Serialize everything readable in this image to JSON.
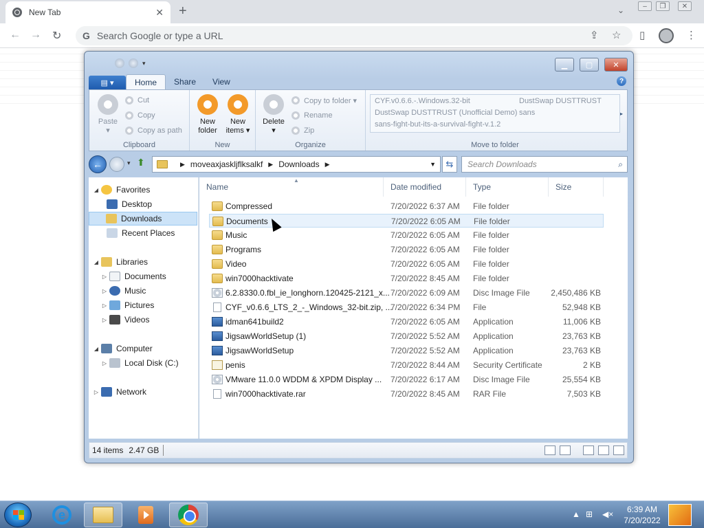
{
  "browser": {
    "tab_title": "New Tab",
    "tab_close": "✕",
    "new_tab": "+",
    "omnibox_placeholder": "Search Google or type a URL",
    "g_letter": "G"
  },
  "explorer": {
    "ribbon_tabs": [
      "Home",
      "Share",
      "View"
    ],
    "clipboard": {
      "paste": "Paste",
      "cut": "Cut",
      "copy": "Copy",
      "copy_as_path": "Copy as path",
      "label": "Clipboard"
    },
    "new_group": {
      "new_folder_1": "New",
      "new_folder_2": "folder",
      "new_items_1": "New",
      "new_items_2": "items ▾",
      "label": "New"
    },
    "organize": {
      "delete": "Delete",
      "copy_to_folder": "Copy to folder ▾",
      "rename": "Rename",
      "zip": "Zip",
      "label": "Organize"
    },
    "move_to": {
      "items": [
        "CYF.v0.6.6.-.Windows.32-bit",
        "DustSwap DUSTTRUST",
        "DustSwap DUSTTRUST (Unofficial Demo)",
        "sans",
        "sans-fight-but-its-a-survival-fight-v.1.2"
      ],
      "label": "Move to folder"
    },
    "address": {
      "segment_1": "moveaxjaskljflksalkf",
      "segment_2": "Downloads"
    },
    "search_placeholder": "Search Downloads",
    "tree": {
      "favorites": "Favorites",
      "desktop": "Desktop",
      "downloads": "Downloads",
      "recent_places": "Recent Places",
      "libraries": "Libraries",
      "documents": "Documents",
      "music": "Music",
      "pictures": "Pictures",
      "videos": "Videos",
      "computer": "Computer",
      "local_disk": "Local Disk (C:)",
      "network": "Network"
    },
    "columns": {
      "name": "Name",
      "date": "Date modified",
      "type": "Type",
      "size": "Size"
    },
    "files": [
      {
        "name": "Compressed",
        "date": "7/20/2022 6:37 AM",
        "type": "File folder",
        "size": "",
        "icon": "folder-icon"
      },
      {
        "name": "Documents",
        "date": "7/20/2022 6:05 AM",
        "type": "File folder",
        "size": "",
        "icon": "folder-icon"
      },
      {
        "name": "Music",
        "date": "7/20/2022 6:05 AM",
        "type": "File folder",
        "size": "",
        "icon": "folder-icon"
      },
      {
        "name": "Programs",
        "date": "7/20/2022 6:05 AM",
        "type": "File folder",
        "size": "",
        "icon": "folder-icon"
      },
      {
        "name": "Video",
        "date": "7/20/2022 6:05 AM",
        "type": "File folder",
        "size": "",
        "icon": "folder-icon"
      },
      {
        "name": "win7000hacktivate",
        "date": "7/20/2022 8:45 AM",
        "type": "File folder",
        "size": "",
        "icon": "folder-icon"
      },
      {
        "name": "6.2.8330.0.fbl_ie_longhorn.120425-2121_x...",
        "date": "7/20/2022 6:09 AM",
        "type": "Disc Image File",
        "size": "2,450,486 KB",
        "icon": "disc-image-icon"
      },
      {
        "name": "CYF_v0.6.6_LTS_2_-_Windows_32-bit.zip, ...",
        "date": "7/20/2022 6:34 PM",
        "type": "File",
        "size": "52,948 KB",
        "icon": "file-icon"
      },
      {
        "name": "idman641build2",
        "date": "7/20/2022 6:05 AM",
        "type": "Application",
        "size": "11,006 KB",
        "icon": "application-icon"
      },
      {
        "name": "JigsawWorldSetup (1)",
        "date": "7/20/2022 5:52 AM",
        "type": "Application",
        "size": "23,763 KB",
        "icon": "application-icon"
      },
      {
        "name": "JigsawWorldSetup",
        "date": "7/20/2022 5:52 AM",
        "type": "Application",
        "size": "23,763 KB",
        "icon": "application-icon"
      },
      {
        "name": "penis",
        "date": "7/20/2022 8:44 AM",
        "type": "Security Certificate",
        "size": "2 KB",
        "icon": "certificate-icon"
      },
      {
        "name": "VMware 11.0.0 WDDM & XPDM Display ...",
        "date": "7/20/2022 6:17 AM",
        "type": "Disc Image File",
        "size": "25,554 KB",
        "icon": "disc-image-icon"
      },
      {
        "name": "win7000hacktivate.rar",
        "date": "7/20/2022 8:45 AM",
        "type": "RAR File",
        "size": "7,503 KB",
        "icon": "file-icon"
      }
    ],
    "status": {
      "items": "14 items",
      "size": "2.47 GB"
    }
  },
  "taskbar": {
    "time": "6:39 AM",
    "date": "7/20/2022"
  },
  "colors": {
    "accent": "#1f5cae",
    "taskbar": "#4a6d98"
  }
}
